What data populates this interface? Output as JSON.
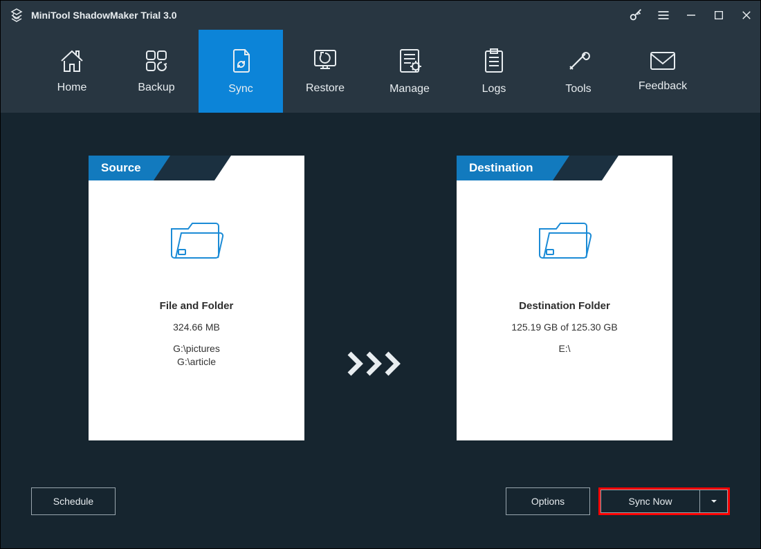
{
  "titlebar": {
    "title": "MiniTool ShadowMaker Trial 3.0"
  },
  "nav": {
    "home": "Home",
    "backup": "Backup",
    "sync": "Sync",
    "restore": "Restore",
    "manage": "Manage",
    "logs": "Logs",
    "tools": "Tools",
    "feedback": "Feedback",
    "active": "sync"
  },
  "source": {
    "header": "Source",
    "heading": "File and Folder",
    "size": "324.66 MB",
    "paths": [
      "G:\\pictures",
      "G:\\article"
    ]
  },
  "destination": {
    "header": "Destination",
    "heading": "Destination Folder",
    "capacity": "125.19 GB of 125.30 GB",
    "paths": [
      "E:\\"
    ]
  },
  "buttons": {
    "schedule": "Schedule",
    "options": "Options",
    "syncnow": "Sync Now"
  }
}
